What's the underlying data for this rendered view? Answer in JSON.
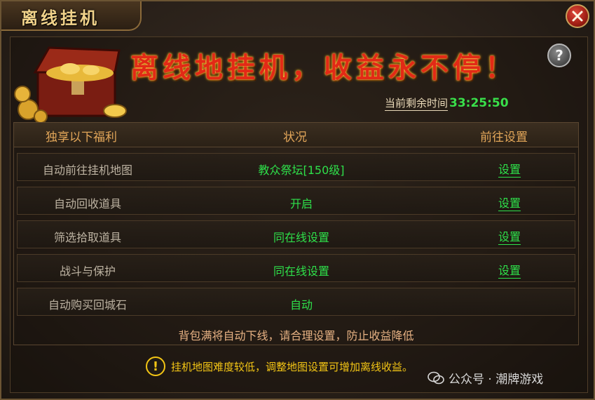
{
  "window": {
    "title": "离线挂机"
  },
  "banner": {
    "headline": "离线地挂机，收益永不停！"
  },
  "help": {
    "label": "?"
  },
  "timer": {
    "label": "当前剩余时间",
    "value": "33:25:50"
  },
  "table": {
    "headers": [
      "独享以下福利",
      "状况",
      "前往设置"
    ],
    "rows": [
      {
        "name": "自动前往挂机地图",
        "status": "教众祭坛[150级]",
        "link": "设置"
      },
      {
        "name": "自动回收道具",
        "status": "开启",
        "link": "设置"
      },
      {
        "name": "筛选拾取道具",
        "status": "同在线设置",
        "link": "设置"
      },
      {
        "name": "战斗与保护",
        "status": "同在线设置",
        "link": "设置"
      },
      {
        "name": "自动购买回城石",
        "status": "自动",
        "link": ""
      }
    ],
    "warning": "背包满将自动下线，请合理设置，防止收益降低"
  },
  "tip": {
    "icon_symbol": "!",
    "text": "挂机地图难度较低，调整地图设置可增加离线收益。"
  },
  "watermark": {
    "text": "公众号 · 潮牌游戏"
  },
  "colors": {
    "accent_green": "#2ee04a",
    "banner_red": "#e22a16",
    "header_gold": "#e2a659",
    "tip_yellow": "#f3c515"
  }
}
